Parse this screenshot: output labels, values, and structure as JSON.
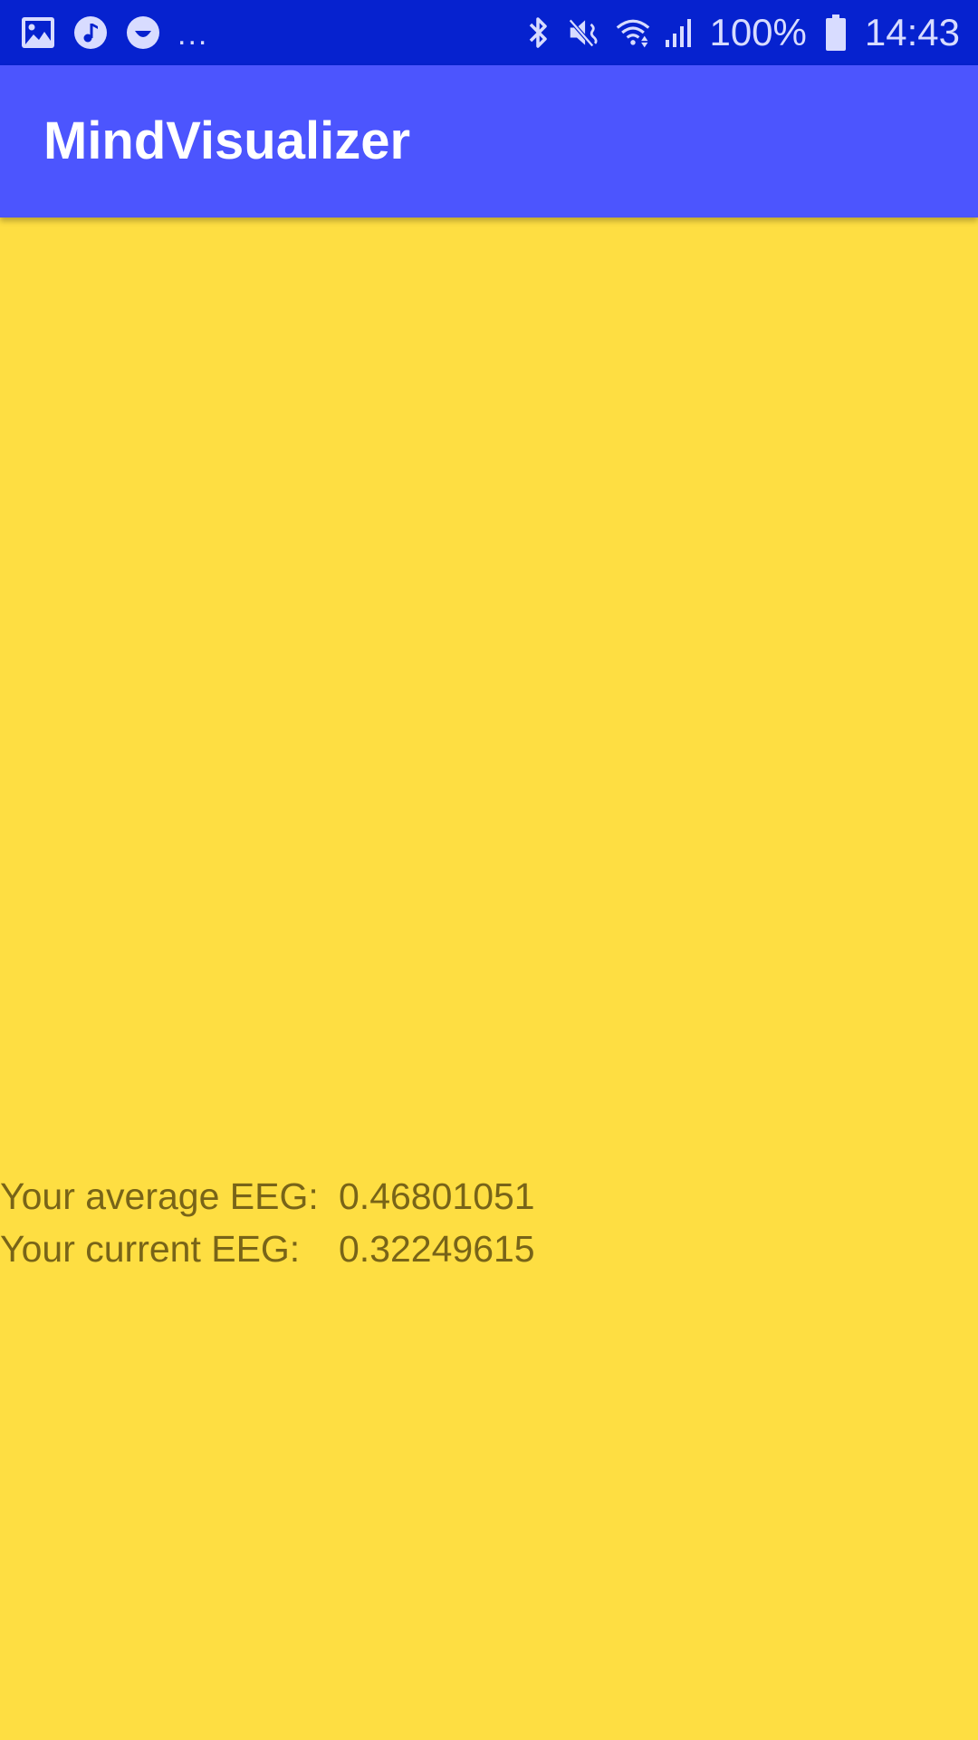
{
  "status_bar": {
    "notification_icons": [
      "gallery-icon",
      "music-icon",
      "smiley-icon"
    ],
    "overflow": "...",
    "system_icons": [
      "bluetooth-icon",
      "mute-icon",
      "wifi-icon",
      "signal-icon"
    ],
    "battery_percent": "100%",
    "time": "14:43"
  },
  "app_bar": {
    "title": "MindVisualizer"
  },
  "eeg": {
    "average_label": "Your average EEG:",
    "average_value": "0.46801051",
    "current_label": "Your current EEG:",
    "current_value": "0.32249615"
  },
  "colors": {
    "status_bar": "#0622cf",
    "app_bar": "#4c55fe",
    "background": "#fede42",
    "text": "#786418"
  }
}
